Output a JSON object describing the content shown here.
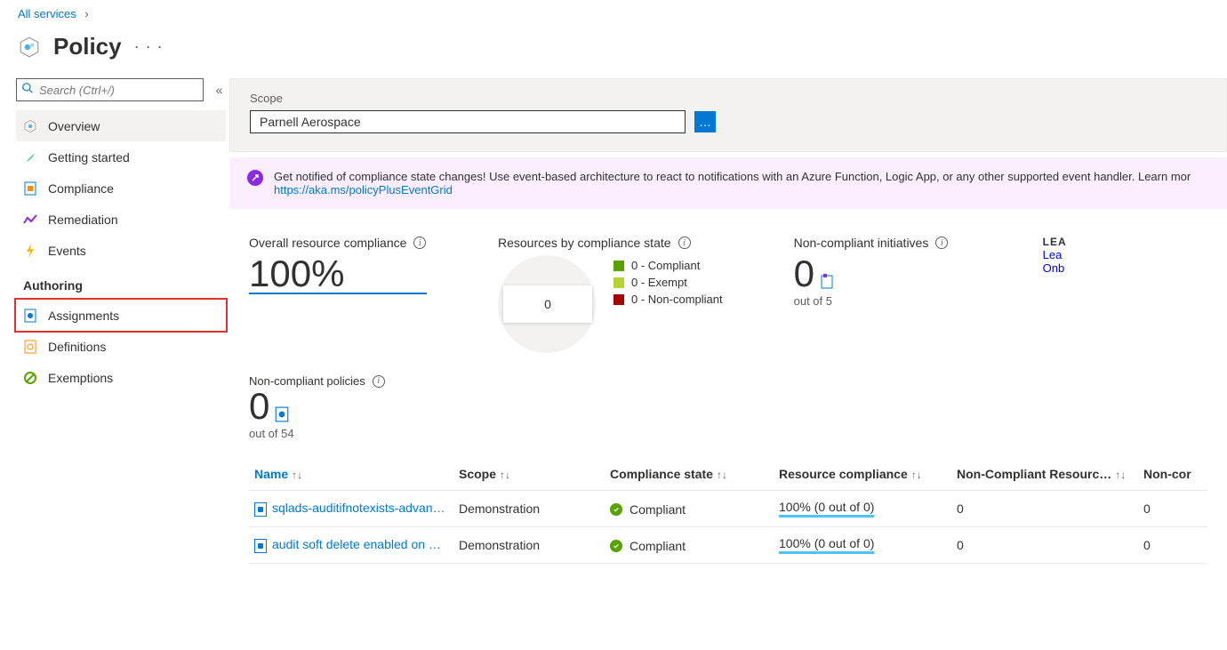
{
  "breadcrumb": {
    "all_services": "All services"
  },
  "title": "Policy",
  "search": {
    "placeholder": "Search (Ctrl+/)"
  },
  "nav": {
    "overview": "Overview",
    "getting_started": "Getting started",
    "compliance": "Compliance",
    "remediation": "Remediation",
    "events": "Events",
    "authoring_label": "Authoring",
    "assignments": "Assignments",
    "definitions": "Definitions",
    "exemptions": "Exemptions"
  },
  "scope": {
    "label": "Scope",
    "value": "Parnell Aerospace",
    "button_glyph": "…"
  },
  "banner": {
    "text": "Get notified of compliance state changes! Use event-based architecture to react to notifications with an Azure Function, Logic App, or any other supported event handler. Learn mor",
    "link": "https://aka.ms/policyPlusEventGrid"
  },
  "metrics": {
    "overall": {
      "label": "Overall resource compliance",
      "value": "100%"
    },
    "by_state": {
      "label": "Resources by compliance state",
      "center": "0",
      "legend": [
        {
          "color": "green",
          "text": "0 - Compliant"
        },
        {
          "color": "yellow",
          "text": "0 - Exempt"
        },
        {
          "color": "red",
          "text": "0 - Non-compliant"
        }
      ]
    },
    "noncompliant_initiatives": {
      "label": "Non-compliant initiatives",
      "value": "0",
      "sub": "out of 5"
    },
    "learn": {
      "header": "LEA",
      "link1": "Lea",
      "link2": "Onb"
    },
    "noncompliant_policies": {
      "label": "Non-compliant policies",
      "value": "0",
      "sub": "out of 54"
    }
  },
  "table": {
    "headers": {
      "name": "Name",
      "scope": "Scope",
      "state": "Compliance state",
      "resource": "Resource compliance",
      "noncomp_res": "Non-Compliant Resourc…",
      "noncomp": "Non-cor"
    },
    "rows": [
      {
        "name": "sqlads-auditifnotexists-advan…",
        "scope": "Demonstration",
        "state": "Compliant",
        "resource": "100% (0 out of 0)",
        "noncomp_res": "0",
        "noncomp": "0"
      },
      {
        "name": "audit soft delete enabled on …",
        "scope": "Demonstration",
        "state": "Compliant",
        "resource": "100% (0 out of 0)",
        "noncomp_res": "0",
        "noncomp": "0"
      }
    ]
  }
}
